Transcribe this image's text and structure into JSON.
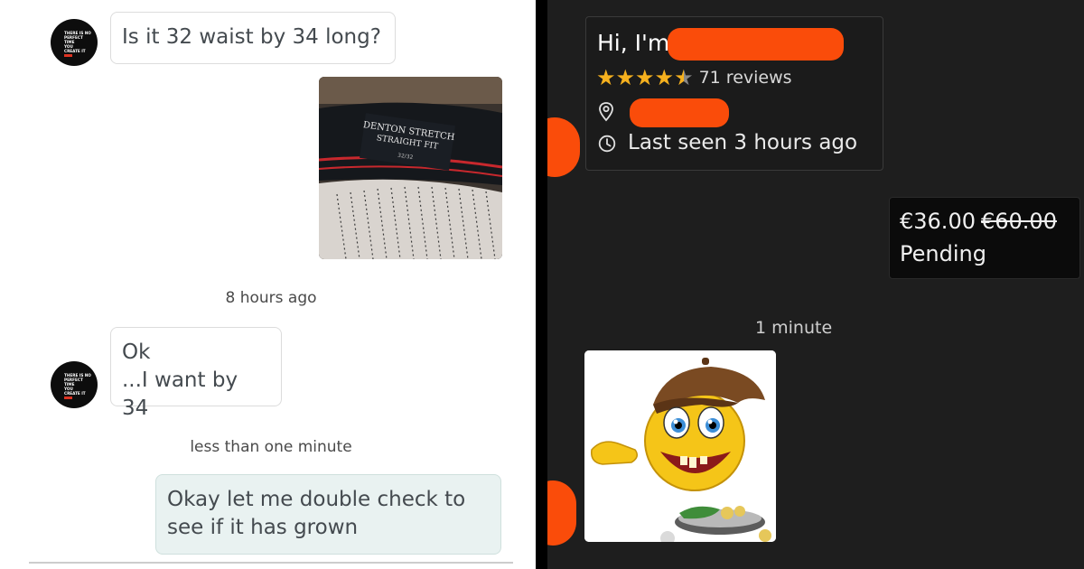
{
  "left_chat": {
    "avatar_text": [
      "THERE IS NO",
      "PERFECT",
      "TIME",
      "YOU",
      "CREATE IT"
    ],
    "msg1": "Is it 32 waist by 34 long?",
    "photo_label_line1": "DENTON STRETCH",
    "photo_label_line2": "STRAIGHT FIT",
    "photo_label_size": "32/32",
    "ts1": "8 hours ago",
    "msg2_line1": "Ok",
    "msg2_line2": "...I want by 34",
    "ts2": "less than one minute",
    "msg3_line1": "Okay let me double check to",
    "msg3_line2": "see if it has grown"
  },
  "right_chat": {
    "greeting": "Hi, I'm",
    "rating": 4.5,
    "reviews": "71 reviews",
    "last_seen": "Last seen 3 hours ago",
    "price_current": "€36.00",
    "price_old": "€60.00",
    "status": "Pending",
    "timestamp": "1 minute",
    "colors": {
      "star": "#f6b11e",
      "redaction": "#fa4c0a",
      "panel_bg": "#1e1e1e"
    },
    "icons": [
      "location-pin-icon",
      "clock-icon",
      "star-icon"
    ]
  }
}
